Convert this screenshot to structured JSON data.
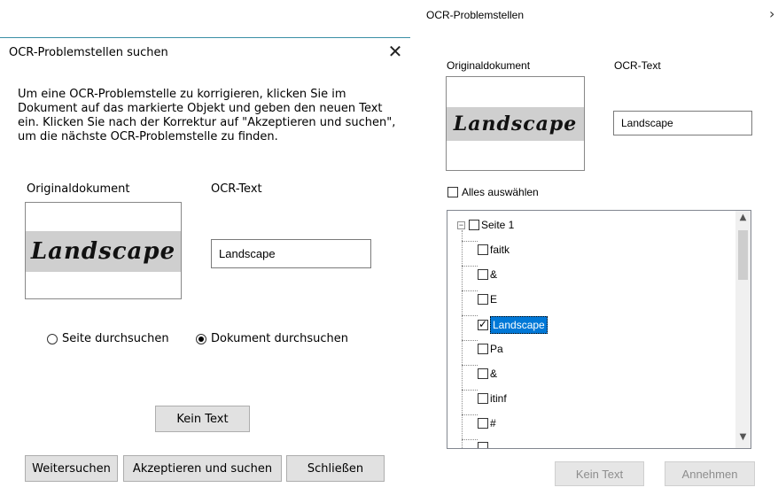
{
  "left_dialog": {
    "title": "OCR-Problemstellen suchen",
    "instruction": "Um eine OCR-Problemstelle zu korrigieren, klicken Sie im Dokument auf das markierte Objekt und geben den neuen Text ein. Klicken Sie nach der Korrektur auf \"Akzeptieren und suchen\", um die nächste OCR-Problemstelle zu finden.",
    "original_label": "Originaldokument",
    "ocr_label": "OCR-Text",
    "scan_word": "Landscape",
    "ocr_value": "Landscape",
    "radio_page": "Seite durchsuchen",
    "radio_document": "Dokument durchsuchen",
    "radio_selected": "document",
    "no_text_button": "Kein Text",
    "find_next_button": "Weitersuchen",
    "accept_find_button": "Akzeptieren und suchen",
    "close_button": "Schließen"
  },
  "right_panel": {
    "title": "OCR-Problemstellen",
    "original_label": "Originaldokument",
    "ocr_label": "OCR-Text",
    "scan_word": "Landscape",
    "ocr_value": "Landscape",
    "select_all_label": "Alles auswählen",
    "tree_root": "Seite 1",
    "tree_items": [
      {
        "label": "faitk",
        "checked": false
      },
      {
        "label": "&",
        "checked": false
      },
      {
        "label": "E",
        "checked": false
      },
      {
        "label": "Landscape",
        "checked": true
      },
      {
        "label": "Pa",
        "checked": false
      },
      {
        "label": "&",
        "checked": false
      },
      {
        "label": "itinf",
        "checked": false
      },
      {
        "label": "#",
        "checked": false
      }
    ],
    "selected_item": "Landscape",
    "no_text_button": "Kein Text",
    "accept_button": "Annehmen"
  },
  "colors": {
    "selection": "#0078d7",
    "accent_line": "#3a8fa6"
  }
}
